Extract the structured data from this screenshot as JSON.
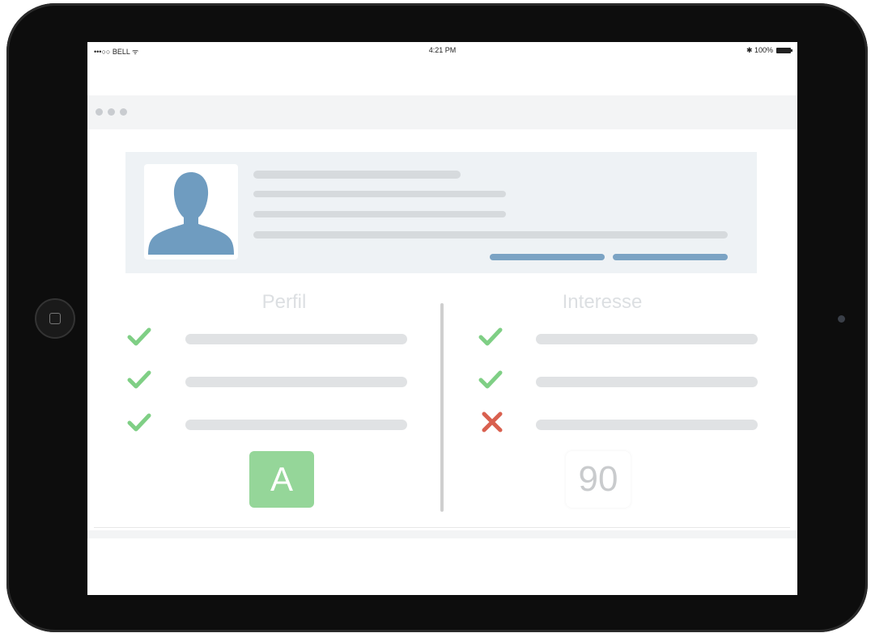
{
  "status_bar": {
    "carrier": "•••○○ BELL ᯤ",
    "time": "4:21 PM",
    "battery": "✱ 100%"
  },
  "colors": {
    "check": "#7fcf85",
    "cross": "#d9604f",
    "avatar": "#6f9cc0",
    "grade_bg": "#95d699",
    "accent_bar": "#7ba3c4"
  },
  "perfil": {
    "title": "Perfil",
    "items": [
      {
        "status": "check-icon"
      },
      {
        "status": "check-icon"
      },
      {
        "status": "check-icon"
      }
    ],
    "grade": "A"
  },
  "interesse": {
    "title": "Interesse",
    "items": [
      {
        "status": "check-icon"
      },
      {
        "status": "check-icon"
      },
      {
        "status": "cross-icon"
      }
    ],
    "score": "90"
  }
}
